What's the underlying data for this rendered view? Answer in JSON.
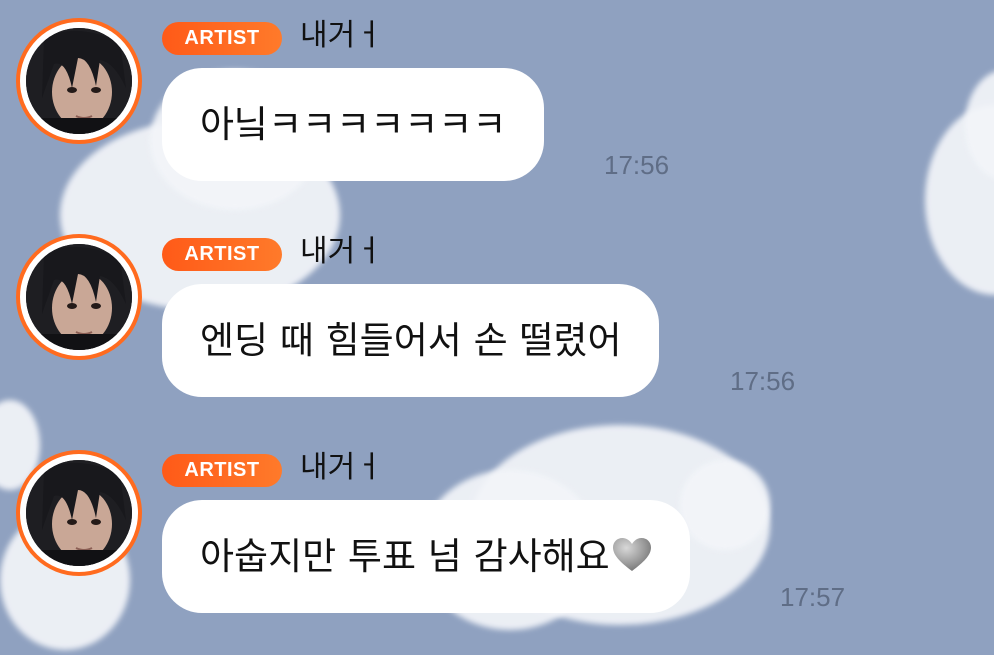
{
  "chat": {
    "background_color": "#8fa1c0",
    "accent_color": "#ff6b1f",
    "messages": [
      {
        "badge": "ARTIST",
        "sender": "내거ㅓ",
        "text": "아닠ㅋㅋㅋㅋㅋㅋㅋ",
        "time": "17:56",
        "avatar_icon": "profile-photo"
      },
      {
        "badge": "ARTIST",
        "sender": "내거ㅓ",
        "text": "엔딩 때 힘들어서 손 떨렸어",
        "time": "17:56",
        "avatar_icon": "profile-photo"
      },
      {
        "badge": "ARTIST",
        "sender": "내거ㅓ",
        "text": "아숩지만 투표 넘 감사해요",
        "emoji": "grey-heart-icon",
        "time": "17:57",
        "avatar_icon": "profile-photo"
      }
    ]
  }
}
